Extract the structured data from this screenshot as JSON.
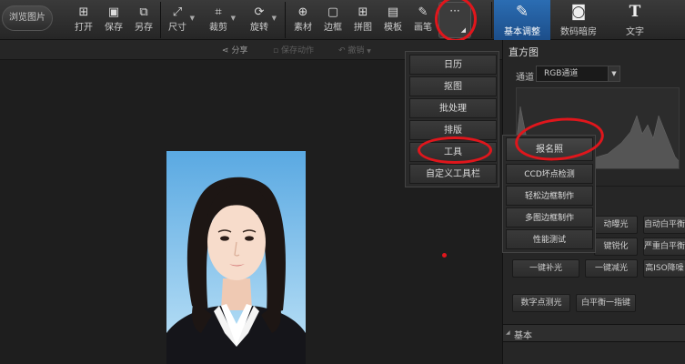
{
  "toolbar": {
    "browse_label": "浏览图片",
    "tools": [
      {
        "label": "打开",
        "icon": "open-icon"
      },
      {
        "label": "保存",
        "icon": "save-icon"
      },
      {
        "label": "另存",
        "icon": "save-as-icon"
      },
      {
        "label": "尺寸",
        "icon": "resize-icon"
      },
      {
        "label": "裁剪",
        "icon": "crop-icon"
      },
      {
        "label": "旋转",
        "icon": "rotate-icon"
      },
      {
        "label": "素材",
        "icon": "material-icon"
      },
      {
        "label": "边框",
        "icon": "border-icon"
      },
      {
        "label": "拼图",
        "icon": "collage-icon"
      },
      {
        "label": "模板",
        "icon": "template-icon"
      },
      {
        "label": "画笔",
        "icon": "brush-icon"
      }
    ],
    "more_label": "···",
    "tabs": [
      {
        "label": "基本调整",
        "icon": "edit-icon",
        "active": true
      },
      {
        "label": "数码暗房",
        "icon": "camera-icon",
        "active": false
      },
      {
        "label": "文字",
        "icon": "text-icon",
        "active": false
      }
    ]
  },
  "subbar": {
    "share_label": "分享",
    "save_action_label": "保存动作",
    "undo_label": "撤销"
  },
  "menu": {
    "items": [
      "日历",
      "抠图",
      "批处理",
      "排版",
      "工具",
      "自定义工具栏"
    ]
  },
  "submenu": {
    "items": [
      "报名照",
      "CCD坏点检测",
      "轻松边框制作",
      "多图边框制作",
      "性能测试"
    ]
  },
  "panel": {
    "title": "直方图",
    "channel_label": "通道",
    "channel_value": "RGB通道",
    "buttons_row1": [
      "动曝光",
      "自动白平衡"
    ],
    "buttons_row2": [
      "键锐化",
      "严重白平衡"
    ],
    "buttons_row3": [
      "一键补光",
      "一键减光",
      "高ISO降噪"
    ],
    "buttons_row4": [
      "数字点测光",
      "白平衡一指键"
    ],
    "section_basic": "基本"
  },
  "colors": {
    "accent": "#2b6db3",
    "annotation": "#e0161c"
  }
}
